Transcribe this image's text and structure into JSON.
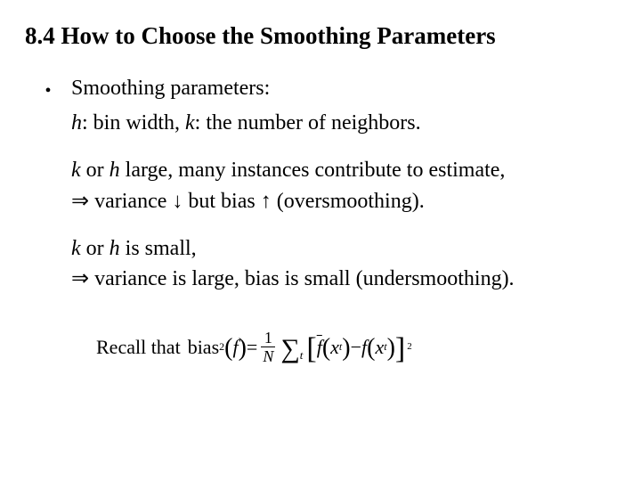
{
  "title": "8.4 How to Choose the Smoothing Parameters",
  "bullet": {
    "label": "Smoothing parameters:",
    "def_h_var": "h",
    "def_h_txt": ": bin width,  ",
    "def_k_var": "k",
    "def_k_txt": ": the number of neighbors."
  },
  "large": {
    "lead_kh": "k",
    "lead_or": " or ",
    "lead_h": "h",
    "lead_rest": " large, many instances contribute to estimate,",
    "arrow": "⇒",
    "var_word": " variance ",
    "down": "↓",
    "but": "  but  bias ",
    "up": "↑",
    "tail": " (oversmoothing)."
  },
  "small": {
    "lead_kh": "k",
    "lead_or": " or ",
    "lead_h": "h",
    "lead_rest": " is small,",
    "arrow": "⇒",
    "line2": " variance is large,  bias is small  (undersmoothing)."
  },
  "formula": {
    "recall": "Recall that ",
    "bias": "bias",
    "sq": "2",
    "open_paren": "(",
    "f": "f",
    "close_paren": ")",
    "eq": " = ",
    "num": "1",
    "den": "N",
    "sigma": "∑",
    "sigma_sub": "t",
    "lbracket": "[",
    "fbar": "f",
    "x": "x",
    "t": "t",
    "minus": " − ",
    "rbracket": "]",
    "outer_sq": "2"
  }
}
